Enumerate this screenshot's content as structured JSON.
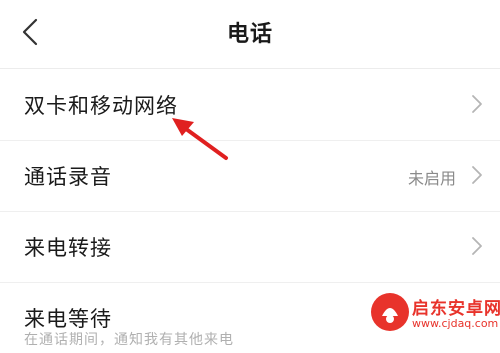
{
  "header": {
    "title": "电话",
    "back_icon": "chevron-left-icon"
  },
  "settings": {
    "items": [
      {
        "label": "双卡和移动网络",
        "value": "",
        "icon": "chevron-right-icon"
      },
      {
        "label": "通话录音",
        "value": "未启用",
        "icon": "chevron-right-icon"
      },
      {
        "label": "来电转接",
        "value": "",
        "icon": "chevron-right-icon"
      },
      {
        "label": "来电等待",
        "value": "",
        "icon": ""
      }
    ],
    "partial_subtext": "在通话期间，通知我有其他来电"
  },
  "annotation": {
    "arrow_color": "#e02020"
  },
  "watermark": {
    "title": "启东安卓网",
    "url": "www.cjdaq.com",
    "color": "#e8332b"
  }
}
